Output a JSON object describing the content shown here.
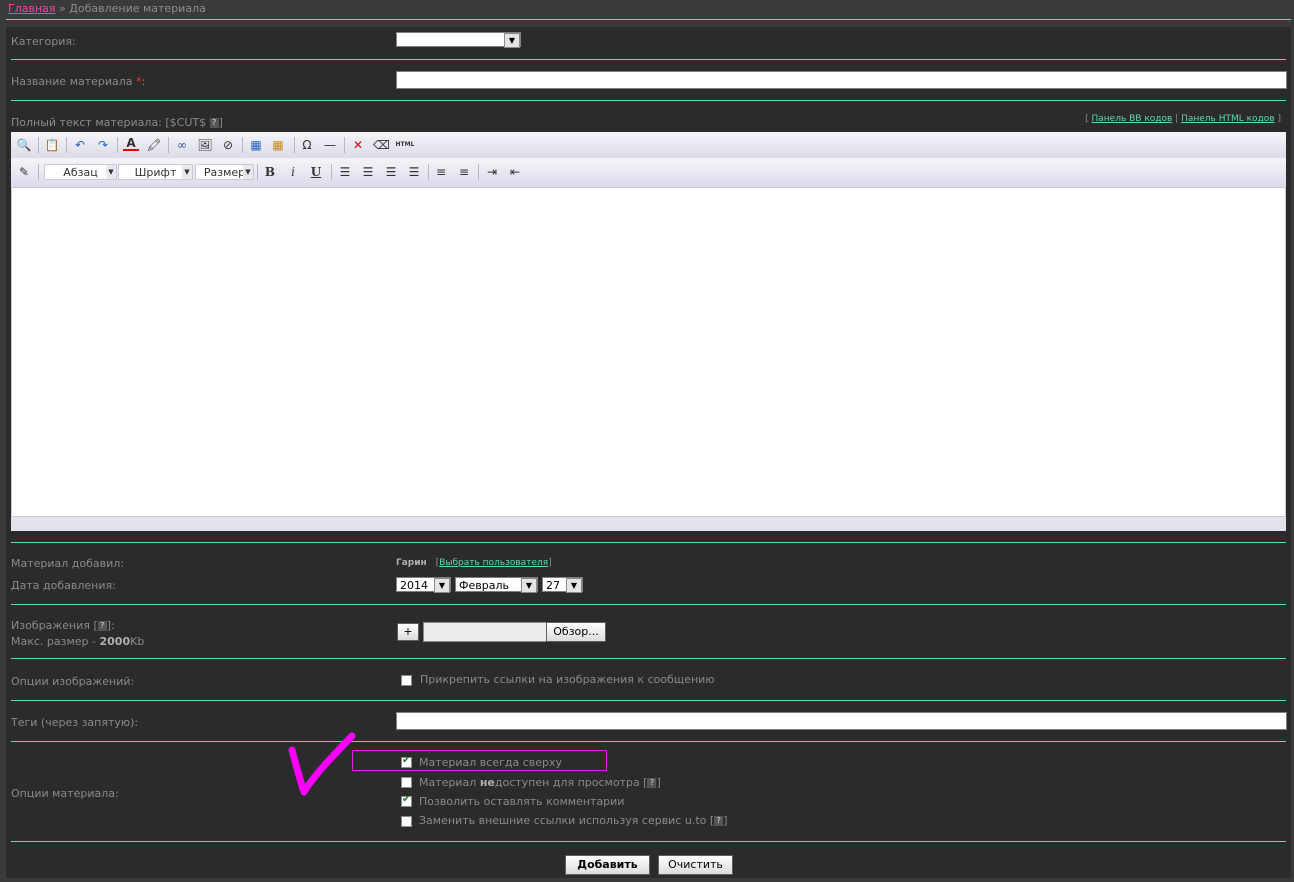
{
  "breadcrumb": {
    "home": "Главная",
    "sep": " » ",
    "current": "Добавление материала"
  },
  "category": {
    "label": "Категория:",
    "value": ""
  },
  "title_field": {
    "label": "Название материала",
    "required": "*",
    "colon": ":",
    "value": ""
  },
  "full_text": {
    "label": "Полный текст материала: [$CUT$",
    "help": "?",
    "close": "]",
    "bb_panel": "Панель BB кодов",
    "html_panel": "Панель HTML кодов",
    "bracket_open": "[",
    "bracket_sep": "|",
    "bracket_close": "]"
  },
  "editor": {
    "format_combo": "Абзац",
    "font_combo": "Шрифт",
    "size_combo": "Размер",
    "bold": "B",
    "italic": "i",
    "underline": "U",
    "html_btn": "HTML"
  },
  "author": {
    "label": "Материал добавил:",
    "name": "Гарин",
    "choose_link": "Выбрать пользователя"
  },
  "date": {
    "label": "Дата добавления:",
    "year": "2014",
    "month": "Февраль",
    "day": "27"
  },
  "images": {
    "label": "Изображения",
    "help": "?",
    "max_label": "Макс. размер - ",
    "max_value": "2000",
    "max_unit": "Kb",
    "add_btn": "+",
    "browse_btn": "Обзор..."
  },
  "image_options": {
    "label": "Опции изображений:",
    "attach_label": "Прикрепить ссылки на изображения к сообщению",
    "attach_checked": false
  },
  "tags": {
    "label": "Теги (через запятую):",
    "value": ""
  },
  "material_options": {
    "label": "Опции материала:",
    "items": [
      {
        "label": "Материал всегда сверху",
        "checked": true
      },
      {
        "label_pre": "Материал ",
        "label_bold": "не",
        "label_post": "доступен для просмотра",
        "checked": false,
        "help": "?"
      },
      {
        "label": "Позволить оставлять комментарии",
        "checked": true
      },
      {
        "label": "Заменить внешние ссылки используя сервис u.to",
        "checked": false,
        "help": "?"
      }
    ]
  },
  "actions": {
    "submit": "Добавить",
    "reset": "Очистить"
  },
  "annotation": {
    "color": "#ff00ff"
  }
}
